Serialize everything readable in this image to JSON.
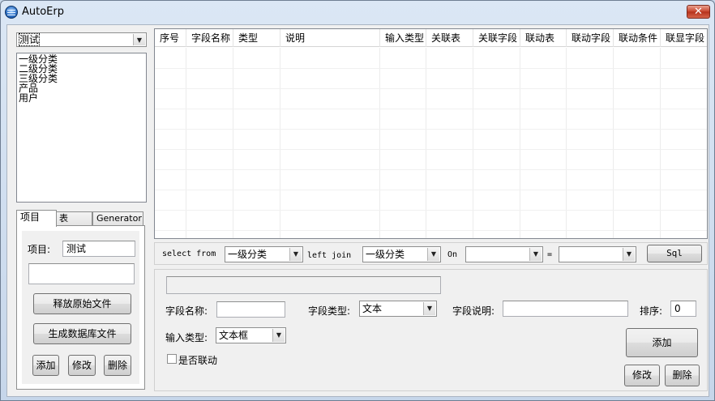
{
  "window": {
    "title": "AutoErp",
    "close_glyph": "✕"
  },
  "project_combo": {
    "value": "测试"
  },
  "category_list": [
    "一级分类",
    "二级分类",
    "三级分类",
    "产品",
    "用户"
  ],
  "tabs": [
    {
      "label": "项目",
      "active": true
    },
    {
      "label": "表",
      "active": false
    },
    {
      "label": "Generator",
      "active": false
    }
  ],
  "project_tab": {
    "project_label": "项目:",
    "project_value": "测试",
    "extra_value": "",
    "release_button": "释放原始文件",
    "generate_button": "生成数据库文件",
    "add_button": "添加",
    "modify_button": "修改",
    "delete_button": "删除"
  },
  "grid": {
    "columns": [
      "序号",
      "字段名称",
      "类型",
      "说明",
      "输入类型",
      "关联表",
      "关联字段",
      "联动表",
      "联动字段",
      "联动条件",
      "联显字段"
    ],
    "rows": []
  },
  "sql_bar": {
    "select_from_label": "select from",
    "select_from_value": "一级分类",
    "left_join_label": "left join",
    "left_join_value": "一级分类",
    "on_label": "On",
    "on_left_value": "",
    "equals_label": "=",
    "on_right_value": "",
    "sql_button": "Sql"
  },
  "field_form": {
    "status_value": "",
    "field_name_label": "字段名称:",
    "field_name_value": "",
    "field_type_label": "字段类型:",
    "field_type_value": "文本",
    "field_desc_label": "字段说明:",
    "field_desc_value": "",
    "sort_label": "排序:",
    "sort_value": "0",
    "input_type_label": "输入类型:",
    "input_type_value": "文本框",
    "linked_label": "是否联动",
    "linked_checked": false,
    "add_button": "添加",
    "modify_button": "修改",
    "delete_button": "删除"
  }
}
